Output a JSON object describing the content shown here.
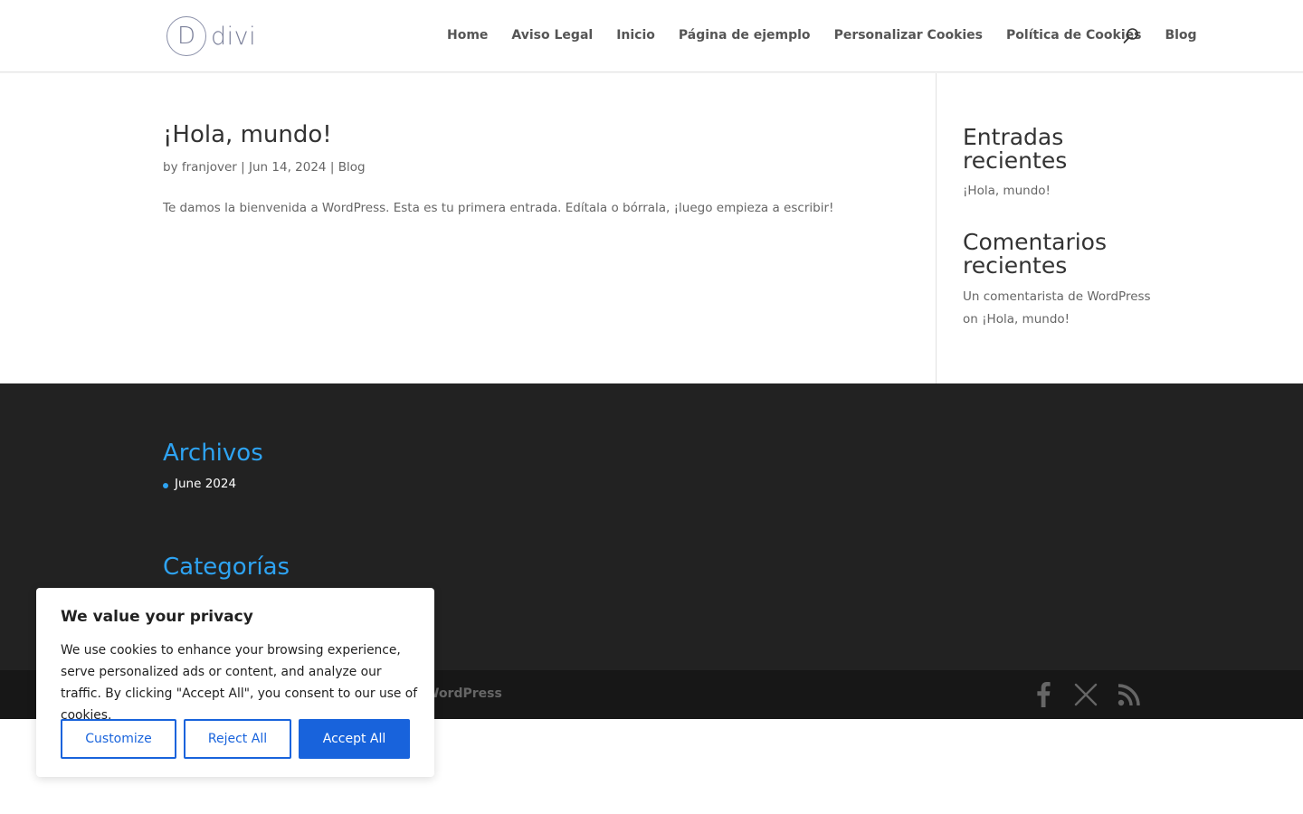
{
  "header": {
    "logo_letter": "D",
    "logo_text": "divi",
    "nav": [
      "Home",
      "Aviso Legal",
      "Inicio",
      "Página de ejemplo",
      "Personalizar Cookies",
      "Política de Cookies",
      "Blog"
    ],
    "search_icon": "search-icon"
  },
  "post": {
    "title": "¡Hola, mundo!",
    "meta_by": "by",
    "author": "franjover",
    "date": "Jun 14, 2024",
    "category": "Blog",
    "separator": "|",
    "excerpt": "Te damos la bienvenida a WordPress. Esta es tu primera entrada. Edítala o bórrala, ¡luego empieza a escribir!"
  },
  "sidebar": {
    "recent_posts_title": "Entradas recientes",
    "recent_posts": [
      "¡Hola, mundo!"
    ],
    "recent_comments_title": "Comentarios recientes",
    "comment_author": "Un comentarista de WordPress",
    "comment_on": "on",
    "comment_post": "¡Hola, mundo!"
  },
  "footer": {
    "archives_title": "Archivos",
    "archives": [
      "June 2024"
    ],
    "categories_title": "Categorías",
    "credits_tail": "WordPress",
    "social_icons": [
      "facebook-icon",
      "x-icon",
      "rss-icon"
    ]
  },
  "cookie_banner": {
    "title": "We value your privacy",
    "text": "We use cookies to enhance your browsing experience, serve personalized ads or content, and analyze our traffic. By clicking \"Accept All\", you consent to our use of cookies.",
    "customize": "Customize",
    "reject": "Reject All",
    "accept": "Accept All"
  },
  "colors": {
    "accent": "#2ea3f2",
    "footer_bg": "#222222",
    "bottom_bar_bg": "#171717",
    "cookie_button": "#1863dc"
  }
}
